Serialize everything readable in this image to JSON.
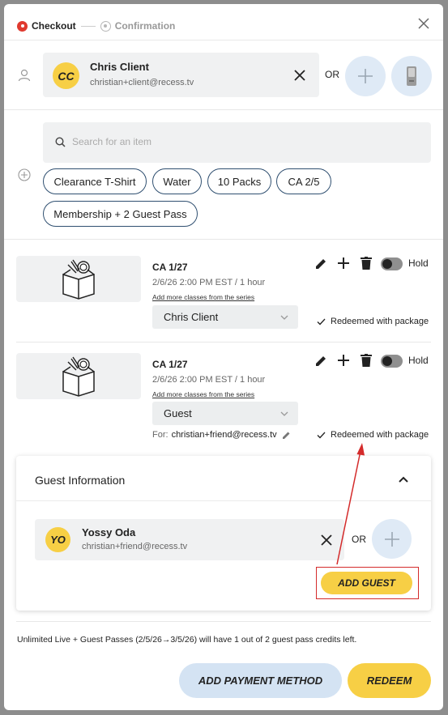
{
  "steps": {
    "checkout": "Checkout",
    "confirmation": "Confirmation"
  },
  "client": {
    "initials": "CC",
    "name": "Chris Client",
    "email": "christian+client@recess.tv"
  },
  "or_label": "OR",
  "search": {
    "placeholder": "Search for an item"
  },
  "chips": [
    "Clearance T-Shirt",
    "Water",
    "10 Packs",
    "CA 2/5",
    "Membership + 2 Guest Pass"
  ],
  "classes": [
    {
      "title": "CA 1/27",
      "time": "2/6/26 2:00 PM EST / 1 hour",
      "link": "Add more classes from the series",
      "attendee": "Chris Client",
      "hold": "Hold",
      "status": "Redeemed with package"
    },
    {
      "title": "CA 1/27",
      "time": "2/6/26 2:00 PM EST / 1 hour",
      "link": "Add more classes from the series",
      "attendee": "Guest",
      "hold": "Hold",
      "status": "Redeemed with package",
      "for_label": "For:",
      "for_email": "christian+friend@recess.tv"
    }
  ],
  "guest_panel": {
    "title": "Guest Information",
    "guest": {
      "initials": "YO",
      "name": "Yossy Oda",
      "email": "christian+friend@recess.tv"
    },
    "add_guest_label": "ADD GUEST"
  },
  "footer": {
    "note": "Unlimited Live + Guest Passes (2/5/26→3/5/26) will have 1 out of 2 guest pass credits left.",
    "add_payment_label": "ADD PAYMENT METHOD",
    "redeem_label": "REDEEM"
  },
  "colors": {
    "accent_yellow": "#f7cf45",
    "accent_blue": "#dfeaf6",
    "annotation_red": "#d42b2b",
    "step_active": "#e03a2f"
  }
}
